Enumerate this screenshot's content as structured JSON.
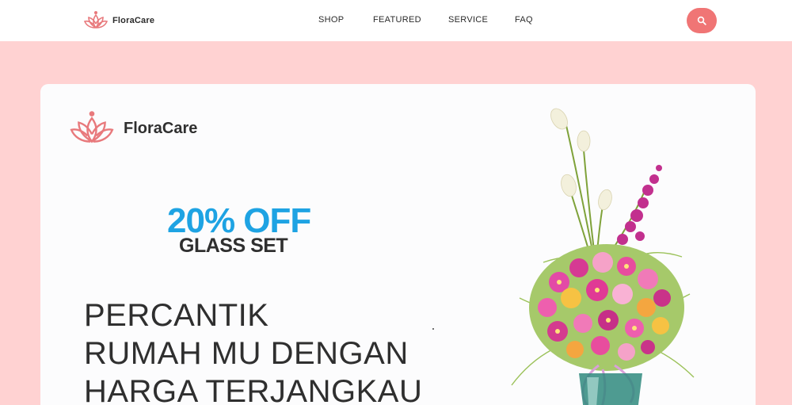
{
  "header": {
    "brand_name": "FloraCare",
    "nav": [
      "SHOP",
      "FEATURED",
      "SERVICE",
      "FAQ"
    ],
    "search_icon": "search-icon"
  },
  "hero": {
    "brand_name": "FloraCare",
    "promo_discount": "20% OFF",
    "promo_item": "GLASS SET",
    "headline": [
      "PERCANTIK",
      "RUMAH MU DENGAN",
      "HARGA TERJANGKAU"
    ]
  },
  "colors": {
    "page_background": "#ffd2d2",
    "accent": "#f07575",
    "promo_blue": "#1ea3e3",
    "text_dark": "#2f2f2f"
  },
  "icons": [
    "lotus-logo-icon",
    "search-icon",
    "flower-bouquet-image"
  ]
}
